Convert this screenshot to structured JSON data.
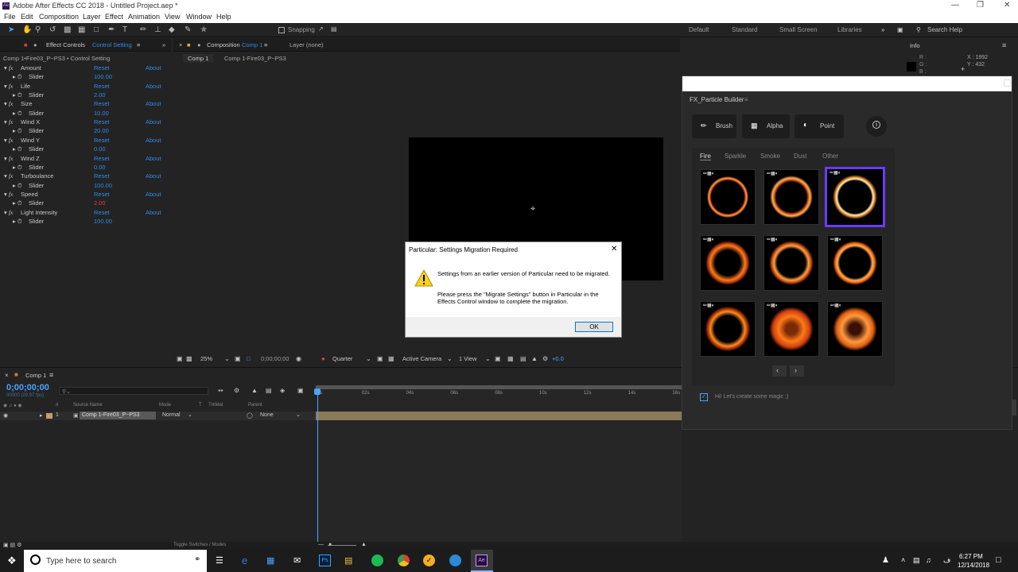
{
  "window": {
    "title": "Adobe After Effects CC 2018 - Untitled Project.aep *",
    "app_icon": "Ae"
  },
  "menu": [
    "File",
    "Edit",
    "Composition",
    "Layer",
    "Effect",
    "Animation",
    "View",
    "Window",
    "Help"
  ],
  "toolbar": {
    "snapping_label": "Snapping",
    "workspaces": [
      "Default",
      "Standard",
      "Small Screen",
      "Libraries"
    ],
    "search_placeholder": "Search Help"
  },
  "effect_controls": {
    "tab_label": "Effect Controls",
    "tab_highlight": "Control Setting",
    "header": "Comp 1•Fire03_P~PS3 • Control Setting",
    "reset_label": "Reset",
    "about_label": "About",
    "sub_label": "Slider",
    "effects": [
      {
        "name": "Amount",
        "value": "100.00"
      },
      {
        "name": "Life",
        "value": "2.00"
      },
      {
        "name": "Size",
        "value": "10.00"
      },
      {
        "name": "Wind X",
        "value": "20.00"
      },
      {
        "name": "Wind Y",
        "value": "0.00"
      },
      {
        "name": "Wind Z",
        "value": "0.00"
      },
      {
        "name": "Turboulance",
        "value": "100.00"
      },
      {
        "name": "Speed",
        "value": "2.00"
      },
      {
        "name": "Light Intensity",
        "value": "100.00"
      }
    ]
  },
  "composition": {
    "tab_label": "Composition",
    "tab_highlight": "Comp 1",
    "layer_tab": "Layer (none)",
    "breadcrumb": [
      "Comp 1",
      "Comp 1-Fire03_P~PS3"
    ],
    "zoom": "25%",
    "timecode": "0;00;00;00",
    "resolution": "Quarter",
    "camera": "Active Camera",
    "views": "1 View",
    "exposure": "+0.0"
  },
  "info": {
    "title": "Info",
    "r": "R :",
    "g": "G :",
    "b": "B :",
    "x": "X : 1992",
    "y": "Y : 432"
  },
  "dialog": {
    "title": "Particular: Settings Migration Required",
    "line1": "Settings from an earlier version of Particular need to be migrated.",
    "line2": "Please press the \"Migrate Settings\" button in Particular in the Effects Control window to complete the migration.",
    "ok": "OK"
  },
  "particle_builder": {
    "title": "FX_Particle Builder",
    "buttons": [
      "Brush",
      "Alpha",
      "Point"
    ],
    "categories": [
      "Fire",
      "Sparkle",
      "Smoke",
      "Dust",
      "Other"
    ],
    "active_category": "Fire",
    "footer_text": "Hi! Let's create some magic ;)",
    "selected_index": 2,
    "thumbs": 9
  },
  "timeline": {
    "comp_tab": "Comp 1",
    "timecode": "0;00;00;00",
    "fps": "00000 (29.97 fps)",
    "columns": [
      "#",
      "Source Name",
      "Mode",
      "T",
      "TrkMat",
      "Parent"
    ],
    "ruler": [
      "0s",
      "02s",
      "04s",
      "06s",
      "08s",
      "10s",
      "12s",
      "14s",
      "16s"
    ],
    "layers": [
      {
        "num": "1",
        "name": "Comp 1-Fire03_P~PS3",
        "mode": "Normal",
        "parent": "None"
      }
    ],
    "toggle_label": "Toggle Switches / Modes"
  },
  "taskbar": {
    "search_placeholder": "Type here to search",
    "time": "6:27 PM",
    "date": "12/14/2018",
    "lang": "ف"
  },
  "colors": {
    "accent": "#2d8ceb",
    "selection": "#6a3cff",
    "fire": "#ff7a18"
  }
}
